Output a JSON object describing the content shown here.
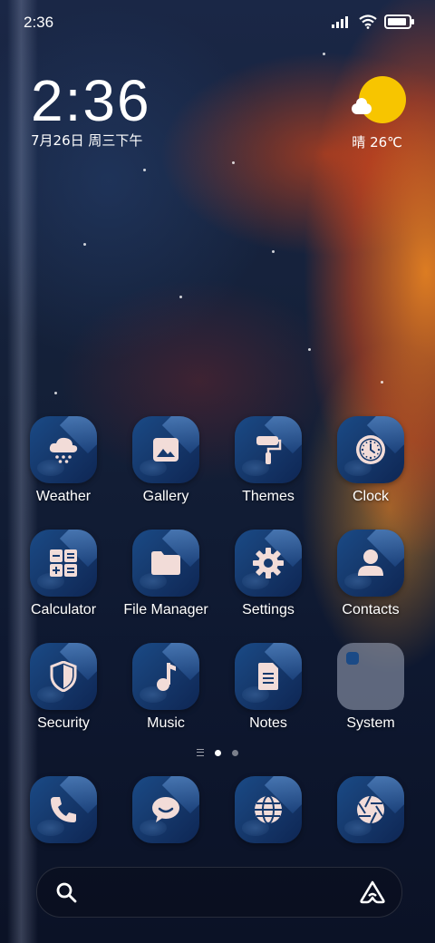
{
  "status_bar": {
    "time": "2:36",
    "battery_level": 0.9
  },
  "clock_widget": {
    "time": "2:36",
    "date": "7月26日 周三下午"
  },
  "weather_widget": {
    "condition_temp": "晴 26℃",
    "icon": "sun-cloud-icon"
  },
  "apps": [
    {
      "label": "Weather",
      "icon": "weather-cloud-snow-icon"
    },
    {
      "label": "Gallery",
      "icon": "image-icon"
    },
    {
      "label": "Themes",
      "icon": "paint-roller-icon"
    },
    {
      "label": "Clock",
      "icon": "clock-icon"
    },
    {
      "label": "Calculator",
      "icon": "calculator-icon"
    },
    {
      "label": "File Manager",
      "icon": "folder-icon"
    },
    {
      "label": "Settings",
      "icon": "gear-icon"
    },
    {
      "label": "Contacts",
      "icon": "person-icon"
    },
    {
      "label": "Security",
      "icon": "shield-icon"
    },
    {
      "label": "Music",
      "icon": "music-note-icon"
    },
    {
      "label": "Notes",
      "icon": "note-icon"
    },
    {
      "label": "System",
      "icon": "folder-group-icon"
    }
  ],
  "page_indicator": {
    "pages": 2,
    "active_page": 1
  },
  "dock": [
    {
      "name": "phone",
      "icon": "phone-icon"
    },
    {
      "name": "messages",
      "icon": "chat-bubble-icon"
    },
    {
      "name": "browser",
      "icon": "globe-icon"
    },
    {
      "name": "camera",
      "icon": "camera-shutter-icon"
    }
  ],
  "search": {
    "icon": "search-icon",
    "assistant_icon": "assistant-icon"
  },
  "colors": {
    "sun": "#f7c500",
    "icon_tile": "#163a6e",
    "icon_glyph": "#f2dcd8"
  }
}
